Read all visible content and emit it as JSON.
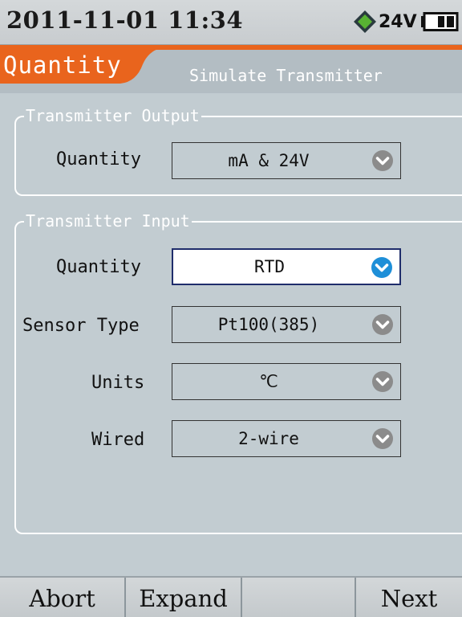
{
  "status": {
    "datetime": "2011-11-01 11:34",
    "voltage": "24V",
    "power_icon": "diamond-power-icon",
    "battery_icon": "battery-icon"
  },
  "tabs": {
    "active": "Quantity",
    "inactive": "Simulate Transmitter"
  },
  "transmitter_output": {
    "title": "Transmitter Output",
    "quantity_label": "Quantity",
    "quantity_value": "mA & 24V"
  },
  "transmitter_input": {
    "title": "Transmitter Input",
    "quantity_label": "Quantity",
    "quantity_value": "RTD",
    "sensor_label": "Sensor Type",
    "sensor_value": "Pt100(385)",
    "units_label": "Units",
    "units_value": "℃",
    "wired_label": "Wired",
    "wired_value": "2-wire"
  },
  "softkeys": {
    "abort": "Abort",
    "expand": "Expand",
    "blank": "",
    "next": "Next"
  },
  "colors": {
    "accent": "#e9641d",
    "background": "#c2ccd1",
    "active_chevron": "#1e8fd8",
    "inactive_chevron": "#8b8b8b"
  }
}
